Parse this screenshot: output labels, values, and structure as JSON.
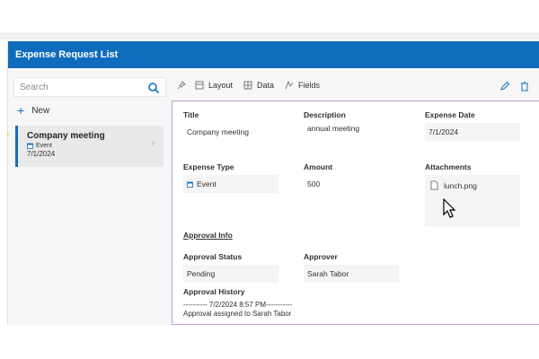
{
  "header": {
    "title": "Expense Request List"
  },
  "left": {
    "search_placeholder": "Search",
    "new_label": "New",
    "card": {
      "title": "Company meeting",
      "category": "Event",
      "date": "7/1/2024"
    }
  },
  "toolbar": {
    "layout": "Layout",
    "data": "Data",
    "fields": "Fields"
  },
  "form": {
    "fields": {
      "title": {
        "label": "Title",
        "value": "Company meeting"
      },
      "description": {
        "label": "Description",
        "value": "annual meeting"
      },
      "expense_date": {
        "label": "Expense Date",
        "value": "7/1/2024"
      },
      "expense_type": {
        "label": "Expense Type",
        "value": "Event"
      },
      "amount": {
        "label": "Amount",
        "value": "500"
      },
      "attachments": {
        "label": "Attachments",
        "file": "lunch.png"
      }
    },
    "approval": {
      "heading": "Approval Info",
      "status": {
        "label": "Approval Status",
        "value": "Pending"
      },
      "approver": {
        "label": "Approver",
        "value": "Sarah Tabor"
      },
      "history": {
        "label": "Approval History",
        "line1": "---------- 7/2/2024 8:57 PM-----------",
        "line2": "Approval assigned to Sarah Tabor"
      }
    }
  },
  "colors": {
    "header_bg": "#0f6cbd",
    "accent": "#0f6cbd",
    "form_border": "#c29ccc"
  }
}
